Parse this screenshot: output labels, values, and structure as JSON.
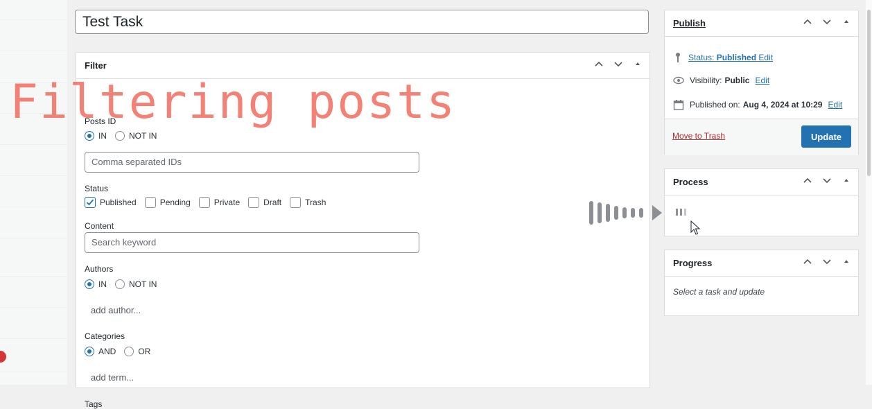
{
  "title_input": {
    "value": "Test Task"
  },
  "filter": {
    "heading": "Filter",
    "posts_id": {
      "label": "Posts ID",
      "options": [
        "IN",
        "NOT IN"
      ],
      "selected": "IN",
      "placeholder": "Comma separated IDs"
    },
    "status": {
      "label": "Status",
      "options": [
        {
          "label": "Published",
          "checked": true
        },
        {
          "label": "Pending",
          "checked": false
        },
        {
          "label": "Private",
          "checked": false
        },
        {
          "label": "Draft",
          "checked": false
        },
        {
          "label": "Trash",
          "checked": false
        }
      ]
    },
    "content": {
      "label": "Content",
      "placeholder": "Search keyword"
    },
    "authors": {
      "label": "Authors",
      "options": [
        "IN",
        "NOT IN"
      ],
      "selected": "IN",
      "add_label": "add author..."
    },
    "categories": {
      "label": "Categories",
      "options": [
        "AND",
        "OR"
      ],
      "selected": "AND",
      "add_label": "add term..."
    },
    "tags": {
      "label": "Tags"
    }
  },
  "publish": {
    "heading": "Publish",
    "status_prefix": "Status:",
    "status_value": "Published",
    "status_edit": "Edit",
    "visibility_prefix": "Visibility:",
    "visibility_value": "Public",
    "visibility_edit": "Edit",
    "published_prefix": "Published on:",
    "published_value": "Aug 4, 2024 at 10:29",
    "published_edit": "Edit",
    "trash_label": "Move to Trash",
    "update_label": "Update"
  },
  "process": {
    "heading": "Process"
  },
  "progress": {
    "heading": "Progress",
    "placeholder_text": "Select a task and update"
  },
  "overlay": {
    "text": "Filtering posts"
  },
  "colors": {
    "accent": "#2271b1",
    "overlay": "#f2776a",
    "trash": "#b32d2e",
    "badge": "#d63638"
  },
  "icons": [
    "chevron-up-icon",
    "chevron-down-icon",
    "collapse-triangle-icon",
    "pin-icon",
    "eye-icon",
    "calendar-icon",
    "loader-icon",
    "mouse-cursor-icon",
    "arrow-icon"
  ]
}
